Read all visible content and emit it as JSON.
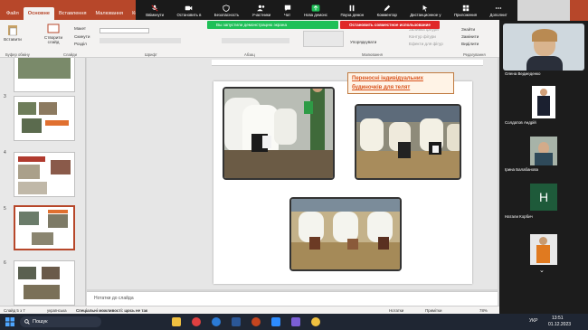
{
  "ribbon": {
    "tabs": [
      "Файл",
      "Основне",
      "Вставлення",
      "Малювання",
      "Конструктор",
      "Переходи",
      "Анімація",
      "Слайд-шоу",
      "Рецензування",
      "Вигляд",
      "Довідка"
    ],
    "paste": "Вставити",
    "create_slide": "Створити слайд",
    "layout": "Макет",
    "reset": "Скинути",
    "sections": "Розділ",
    "arrange": "Упорядкувати",
    "shape_fill": "Заливка фігури",
    "shape_outline": "Контур фігури",
    "shape_effects": "Ефекти для фігур",
    "find": "Знайти",
    "replace": "Замінити",
    "select": "Виділити",
    "groups": {
      "clipboard": "Буфер обміну",
      "slides": "Слайди",
      "font": "Шрифт",
      "paragraph": "Абзац",
      "drawing": "Малювання",
      "editing": "Редагування"
    }
  },
  "zoom_toolbar": {
    "buttons": [
      {
        "icon": "mic-icon",
        "label": "Ввімкнути"
      },
      {
        "icon": "video-icon",
        "label": "Остановить в"
      },
      {
        "icon": "shield-icon",
        "label": "Безопасность"
      },
      {
        "icon": "participants-icon",
        "label": "Участники",
        "count": "26"
      },
      {
        "icon": "chat-icon",
        "label": "Чат"
      },
      {
        "icon": "share-icon",
        "label": "Нова демонс"
      },
      {
        "icon": "pause-icon",
        "label": "Пауза демон"
      },
      {
        "icon": "comment-icon",
        "label": "Комментар"
      },
      {
        "icon": "remote-icon",
        "label": "Дистанционное у"
      },
      {
        "icon": "apps-icon",
        "label": "Приложения"
      },
      {
        "icon": "more-icon",
        "label": "Дополнит"
      }
    ],
    "share_banner": "Вы запустили демонстрацию экрана",
    "stop_share": "Остановить совместное использование"
  },
  "thumbnails": {
    "numbers": [
      "3",
      "4",
      "5",
      "6"
    ]
  },
  "slide": {
    "title_line1": "Переносні індивідуальних",
    "title_line2": "будиночків для телят"
  },
  "notes": {
    "placeholder": "Нотатки до слайда"
  },
  "status": {
    "slide_of": "Слайд 5 з 7",
    "language": "українська",
    "accessibility": "Спеціальні можливості: щось не так",
    "notes_btn": "Нотатки",
    "comments_btn": "Примітки",
    "zoom": "78%"
  },
  "participants": {
    "items": [
      {
        "name": "Олена Ведмеденко"
      },
      {
        "name": "Солдатов Андрій"
      },
      {
        "name": "Ірина Балабанова"
      },
      {
        "name": "Натали Корбич",
        "initial": "Н"
      },
      {
        "name": ""
      }
    ]
  },
  "taskbar": {
    "search": "Пошук",
    "lang": "УКР",
    "time": "13:51",
    "date": "01.12.2023"
  }
}
